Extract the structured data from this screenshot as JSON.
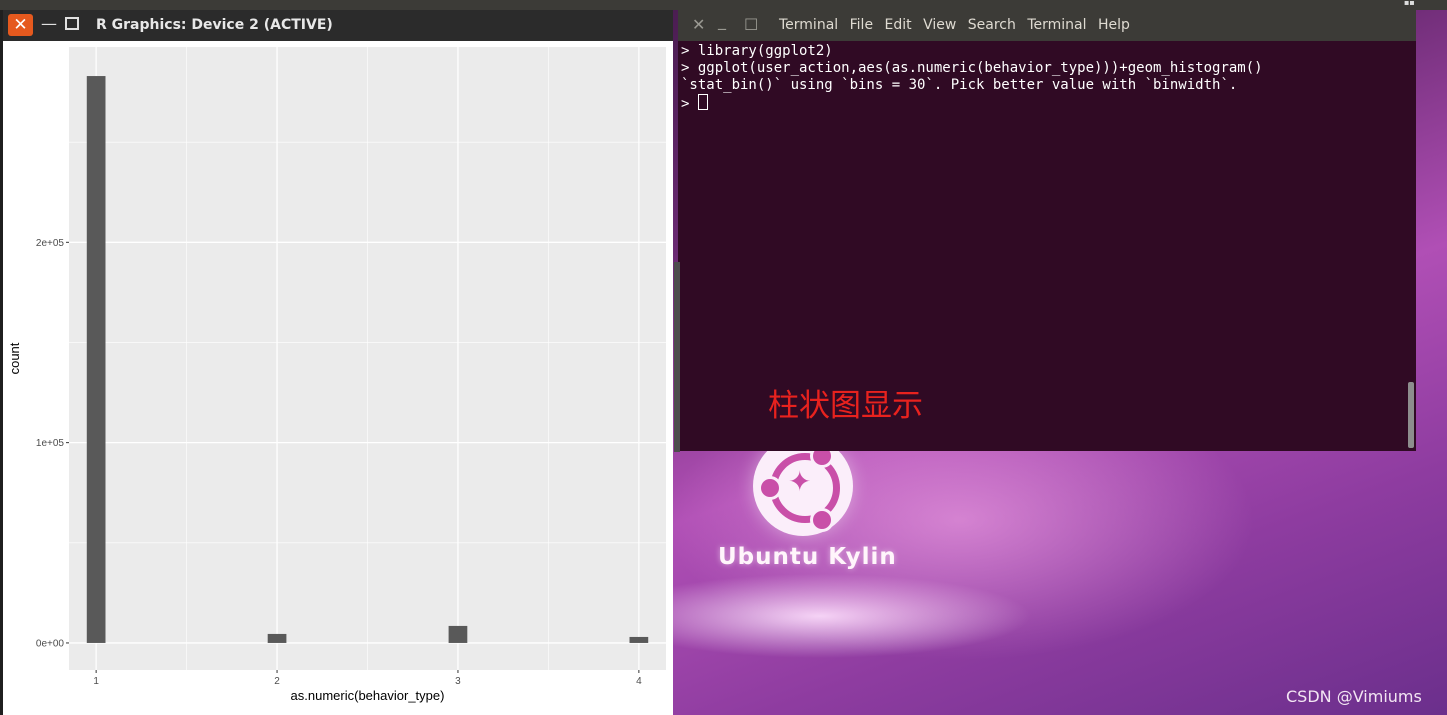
{
  "desktop": {
    "logo_text": "Ubuntu Kylin",
    "watermark": "CSDN @Vimiums"
  },
  "terminal": {
    "menu": [
      "Terminal",
      "File",
      "Edit",
      "View",
      "Search",
      "Terminal",
      "Help"
    ],
    "lines": [
      "> library(ggplot2)",
      "> ggplot(user_action,aes(as.numeric(behavior_type)))+geom_histogram()",
      "`stat_bin()` using `bins = 30`. Pick better value with `binwidth`."
    ],
    "prompt": "> ",
    "annotation": "柱状图显示",
    "colors": {
      "background": "#300a24",
      "annotation": "#e8221e"
    }
  },
  "r_window": {
    "title": "R Graphics: Device 2 (ACTIVE)",
    "close_glyph": "✕",
    "minimize_glyph": "—"
  },
  "chart_data": {
    "type": "bar",
    "xlabel": "as.numeric(behavior_type)",
    "ylabel": "count",
    "xlim": [
      0.85,
      4.15
    ],
    "ylim": [
      -13500,
      297500
    ],
    "x_ticks": [
      1,
      2,
      3,
      4
    ],
    "x_tick_labels": [
      "1",
      "2",
      "3",
      "4"
    ],
    "y_ticks": [
      0,
      100000,
      200000
    ],
    "y_tick_labels": [
      "0e+00",
      "1e+05",
      "2e+05"
    ],
    "binwidth": 0.1034,
    "bars": [
      {
        "x": 1,
        "value": 283000
      },
      {
        "x": 2,
        "value": 4500
      },
      {
        "x": 3,
        "value": 8500
      },
      {
        "x": 4,
        "value": 3000
      }
    ],
    "grid": true,
    "colors": {
      "panel": "#ebebeb",
      "bar": "#595959",
      "grid": "#ffffff"
    }
  }
}
